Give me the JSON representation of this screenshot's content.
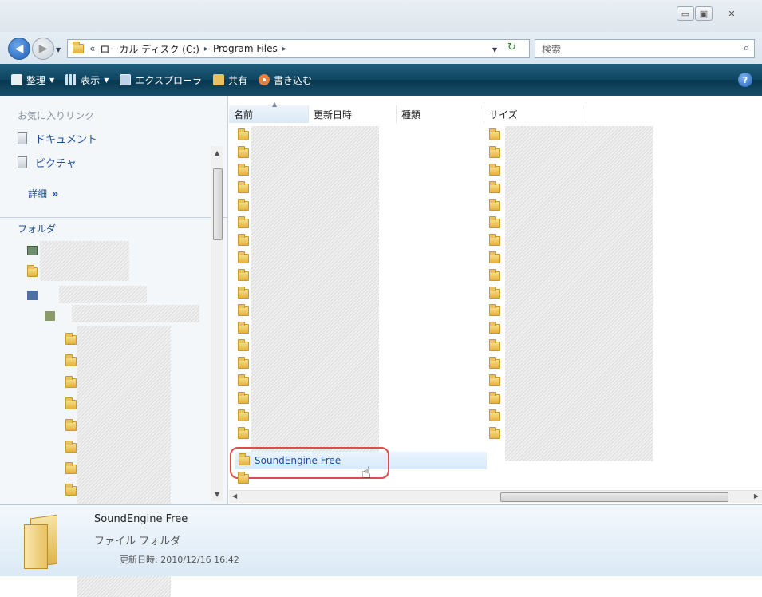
{
  "window": {
    "minimize_glyph": "▭",
    "maximize_glyph": "▣",
    "close_glyph": "✕"
  },
  "address_bar": {
    "chevron": "«",
    "crumbs": [
      "ローカル ディスク (C:)",
      "Program Files"
    ],
    "separator": "▸",
    "search_placeholder": "検索"
  },
  "toolbar": {
    "organize": "整理",
    "views": "表示",
    "explore": "エクスプローラ",
    "share": "共有",
    "burn": "書き込む"
  },
  "nav_pane": {
    "favorites_title": "お気に入りリンク",
    "favorites": [
      "ドキュメント",
      "ピクチャ"
    ],
    "more_label": "詳細",
    "more_chevron": "»",
    "folders_title": "フォルダ",
    "folders_chevron": "⌄"
  },
  "file_list": {
    "columns": [
      "名前",
      "更新日時",
      "種類",
      "サイズ"
    ],
    "selected_item": "SoundEngine Free",
    "highlight_color": "#e04a4a"
  },
  "details": {
    "name": "SoundEngine Free",
    "type": "ファイル フォルダ",
    "modified": "更新日時: 2010/12/16 16:42"
  },
  "colors": {
    "toolbar": "#0f4561",
    "link": "#1e4f9c",
    "selection": "#d7eafb"
  }
}
